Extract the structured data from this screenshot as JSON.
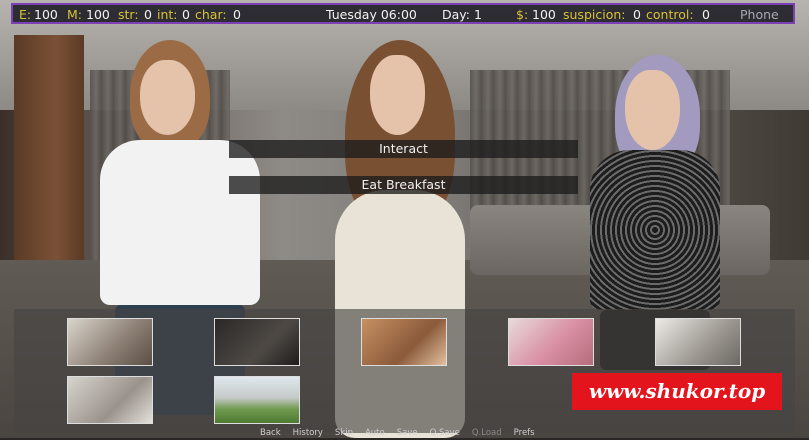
{
  "hud": {
    "energy_label": "E:",
    "energy_value": "100",
    "mana_label": "M:",
    "mana_value": "100",
    "str_label": "str:",
    "str_value": "0",
    "int_label": "int:",
    "int_value": "0",
    "char_label": "char:",
    "char_value": "0",
    "time": "Tuesday 06:00",
    "day": "Day: 1",
    "money_label": "$:",
    "money_value": "100",
    "suspicion_label": "suspicion:",
    "suspicion_value": "0",
    "control_label": "control:",
    "control_value": "0",
    "phone": "Phone"
  },
  "menu": {
    "choices": [
      "Interact",
      "Eat Breakfast"
    ]
  },
  "locations": [
    {
      "icon": "bedroom-thumbnail"
    },
    {
      "icon": "dark-room-thumbnail"
    },
    {
      "icon": "kitchen-thumbnail"
    },
    {
      "icon": "pink-living-room-thumbnail"
    },
    {
      "icon": "bathroom-thumbnail"
    },
    {
      "icon": "hallway-thumbnail"
    },
    {
      "icon": "outdoor-street-thumbnail"
    }
  ],
  "quick_menu": [
    "Back",
    "History",
    "Skip",
    "Auto",
    "Save",
    "Q.Save",
    "Q.Load",
    "Prefs"
  ],
  "watermark": "www.shukor.top",
  "colors": {
    "hud_border": "#7d3fb6",
    "hud_label": "#d9c234",
    "watermark_bg": "#e3141b"
  }
}
